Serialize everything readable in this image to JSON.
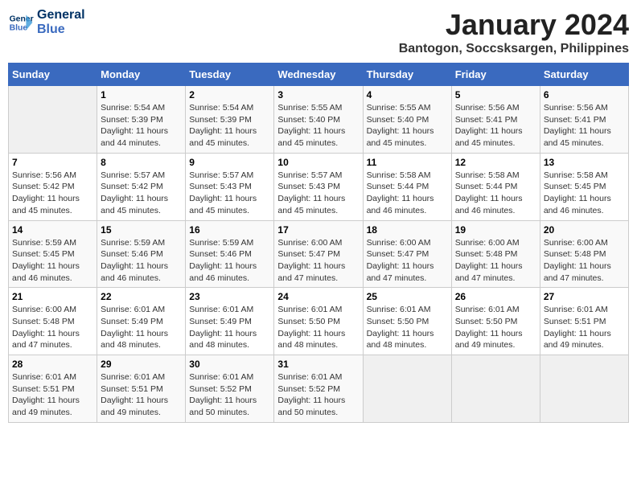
{
  "logo": {
    "line1": "General",
    "line2": "Blue"
  },
  "title": "January 2024",
  "location": "Bantogon, Soccsksargen, Philippines",
  "weekdays": [
    "Sunday",
    "Monday",
    "Tuesday",
    "Wednesday",
    "Thursday",
    "Friday",
    "Saturday"
  ],
  "weeks": [
    [
      {
        "day": "",
        "info": ""
      },
      {
        "day": "1",
        "info": "Sunrise: 5:54 AM\nSunset: 5:39 PM\nDaylight: 11 hours\nand 44 minutes."
      },
      {
        "day": "2",
        "info": "Sunrise: 5:54 AM\nSunset: 5:39 PM\nDaylight: 11 hours\nand 45 minutes."
      },
      {
        "day": "3",
        "info": "Sunrise: 5:55 AM\nSunset: 5:40 PM\nDaylight: 11 hours\nand 45 minutes."
      },
      {
        "day": "4",
        "info": "Sunrise: 5:55 AM\nSunset: 5:40 PM\nDaylight: 11 hours\nand 45 minutes."
      },
      {
        "day": "5",
        "info": "Sunrise: 5:56 AM\nSunset: 5:41 PM\nDaylight: 11 hours\nand 45 minutes."
      },
      {
        "day": "6",
        "info": "Sunrise: 5:56 AM\nSunset: 5:41 PM\nDaylight: 11 hours\nand 45 minutes."
      }
    ],
    [
      {
        "day": "7",
        "info": "Sunrise: 5:56 AM\nSunset: 5:42 PM\nDaylight: 11 hours\nand 45 minutes."
      },
      {
        "day": "8",
        "info": "Sunrise: 5:57 AM\nSunset: 5:42 PM\nDaylight: 11 hours\nand 45 minutes."
      },
      {
        "day": "9",
        "info": "Sunrise: 5:57 AM\nSunset: 5:43 PM\nDaylight: 11 hours\nand 45 minutes."
      },
      {
        "day": "10",
        "info": "Sunrise: 5:57 AM\nSunset: 5:43 PM\nDaylight: 11 hours\nand 45 minutes."
      },
      {
        "day": "11",
        "info": "Sunrise: 5:58 AM\nSunset: 5:44 PM\nDaylight: 11 hours\nand 46 minutes."
      },
      {
        "day": "12",
        "info": "Sunrise: 5:58 AM\nSunset: 5:44 PM\nDaylight: 11 hours\nand 46 minutes."
      },
      {
        "day": "13",
        "info": "Sunrise: 5:58 AM\nSunset: 5:45 PM\nDaylight: 11 hours\nand 46 minutes."
      }
    ],
    [
      {
        "day": "14",
        "info": "Sunrise: 5:59 AM\nSunset: 5:45 PM\nDaylight: 11 hours\nand 46 minutes."
      },
      {
        "day": "15",
        "info": "Sunrise: 5:59 AM\nSunset: 5:46 PM\nDaylight: 11 hours\nand 46 minutes."
      },
      {
        "day": "16",
        "info": "Sunrise: 5:59 AM\nSunset: 5:46 PM\nDaylight: 11 hours\nand 46 minutes."
      },
      {
        "day": "17",
        "info": "Sunrise: 6:00 AM\nSunset: 5:47 PM\nDaylight: 11 hours\nand 47 minutes."
      },
      {
        "day": "18",
        "info": "Sunrise: 6:00 AM\nSunset: 5:47 PM\nDaylight: 11 hours\nand 47 minutes."
      },
      {
        "day": "19",
        "info": "Sunrise: 6:00 AM\nSunset: 5:48 PM\nDaylight: 11 hours\nand 47 minutes."
      },
      {
        "day": "20",
        "info": "Sunrise: 6:00 AM\nSunset: 5:48 PM\nDaylight: 11 hours\nand 47 minutes."
      }
    ],
    [
      {
        "day": "21",
        "info": "Sunrise: 6:00 AM\nSunset: 5:48 PM\nDaylight: 11 hours\nand 47 minutes."
      },
      {
        "day": "22",
        "info": "Sunrise: 6:01 AM\nSunset: 5:49 PM\nDaylight: 11 hours\nand 48 minutes."
      },
      {
        "day": "23",
        "info": "Sunrise: 6:01 AM\nSunset: 5:49 PM\nDaylight: 11 hours\nand 48 minutes."
      },
      {
        "day": "24",
        "info": "Sunrise: 6:01 AM\nSunset: 5:50 PM\nDaylight: 11 hours\nand 48 minutes."
      },
      {
        "day": "25",
        "info": "Sunrise: 6:01 AM\nSunset: 5:50 PM\nDaylight: 11 hours\nand 48 minutes."
      },
      {
        "day": "26",
        "info": "Sunrise: 6:01 AM\nSunset: 5:50 PM\nDaylight: 11 hours\nand 49 minutes."
      },
      {
        "day": "27",
        "info": "Sunrise: 6:01 AM\nSunset: 5:51 PM\nDaylight: 11 hours\nand 49 minutes."
      }
    ],
    [
      {
        "day": "28",
        "info": "Sunrise: 6:01 AM\nSunset: 5:51 PM\nDaylight: 11 hours\nand 49 minutes."
      },
      {
        "day": "29",
        "info": "Sunrise: 6:01 AM\nSunset: 5:51 PM\nDaylight: 11 hours\nand 49 minutes."
      },
      {
        "day": "30",
        "info": "Sunrise: 6:01 AM\nSunset: 5:52 PM\nDaylight: 11 hours\nand 50 minutes."
      },
      {
        "day": "31",
        "info": "Sunrise: 6:01 AM\nSunset: 5:52 PM\nDaylight: 11 hours\nand 50 minutes."
      },
      {
        "day": "",
        "info": ""
      },
      {
        "day": "",
        "info": ""
      },
      {
        "day": "",
        "info": ""
      }
    ]
  ]
}
